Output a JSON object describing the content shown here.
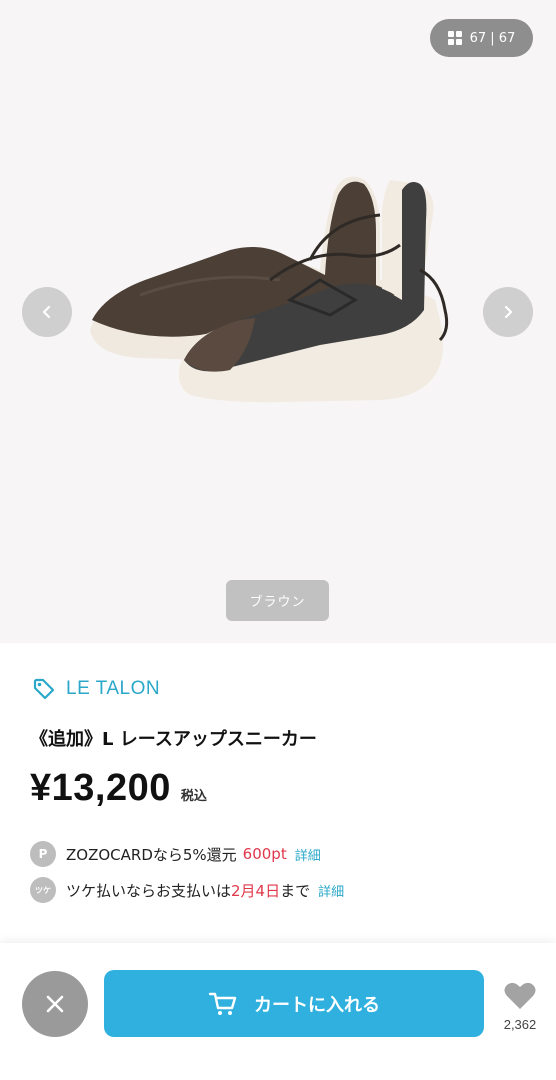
{
  "gallery": {
    "counter_text": "67 | 67",
    "color_label": "ブラウン"
  },
  "product": {
    "brand": "LE TALON",
    "title": "《追加》L レースアップスニーカー",
    "price": "¥13,200",
    "tax_label": "税込"
  },
  "promos": {
    "card": {
      "badge": "P",
      "text": "ZOZOCARDなら5%還元",
      "points": "600pt",
      "link": "詳細"
    },
    "tsuke": {
      "badge": "ツケ",
      "text_before": "ツケ払いならお支払いは",
      "date": "2月4日",
      "text_after": "まで",
      "link": "詳細"
    }
  },
  "actions": {
    "cart_label": "カートに入れる",
    "favorite_count": "2,362"
  },
  "colors": {
    "accent": "#2fb0de",
    "brand_text": "#2aa8c9",
    "highlight": "#e0384b"
  }
}
